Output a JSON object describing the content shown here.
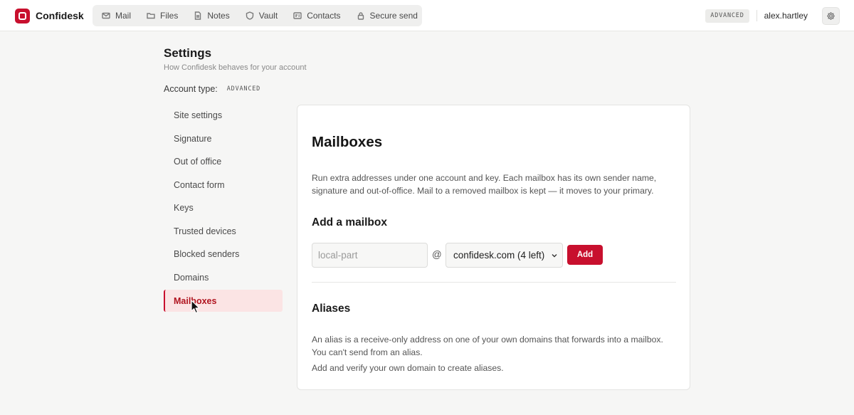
{
  "app": {
    "name": "Confidesk",
    "tier_badge": "ADVANCED",
    "username": "alex.hartley"
  },
  "nav": {
    "items": [
      {
        "label": "Mail",
        "icon": "mail-icon"
      },
      {
        "label": "Files",
        "icon": "folder-icon"
      },
      {
        "label": "Notes",
        "icon": "document-icon"
      },
      {
        "label": "Vault",
        "icon": "shield-icon"
      },
      {
        "label": "Contacts",
        "icon": "address-card-icon"
      },
      {
        "label": "Secure send",
        "icon": "lock-icon"
      }
    ]
  },
  "settings": {
    "title": "Settings",
    "subtitle": "How Confidesk behaves for your account",
    "account_type_label": "Account type:",
    "account_type_value": "ADVANCED"
  },
  "side_menu": {
    "items": [
      {
        "label": "Site settings"
      },
      {
        "label": "Signature"
      },
      {
        "label": "Out of office"
      },
      {
        "label": "Contact form"
      },
      {
        "label": "Keys"
      },
      {
        "label": "Trusted devices"
      },
      {
        "label": "Blocked senders"
      },
      {
        "label": "Domains"
      },
      {
        "label": "Mailboxes",
        "active": true
      }
    ]
  },
  "mailboxes": {
    "title": "Mailboxes",
    "description": "Run extra addresses under one account and key. Each mailbox has its own sender name, signature and out-of-office. Mail to a removed mailbox is kept — it moves to your primary.",
    "add_title": "Add a mailbox",
    "local_part_placeholder": "local-part",
    "local_part_value": "",
    "at_sign": "@",
    "domain_selected": "confidesk.com (4 left)",
    "add_button": "Add"
  },
  "aliases": {
    "title": "Aliases",
    "description": "An alias is a receive-only address on one of your own domains that forwards into a mailbox. You can't send from an alias.",
    "note": "Add and verify your own domain to create aliases."
  },
  "colors": {
    "accent": "#c8102e",
    "active_bg": "#fbe4e4",
    "page_bg": "#f6f6f5"
  }
}
